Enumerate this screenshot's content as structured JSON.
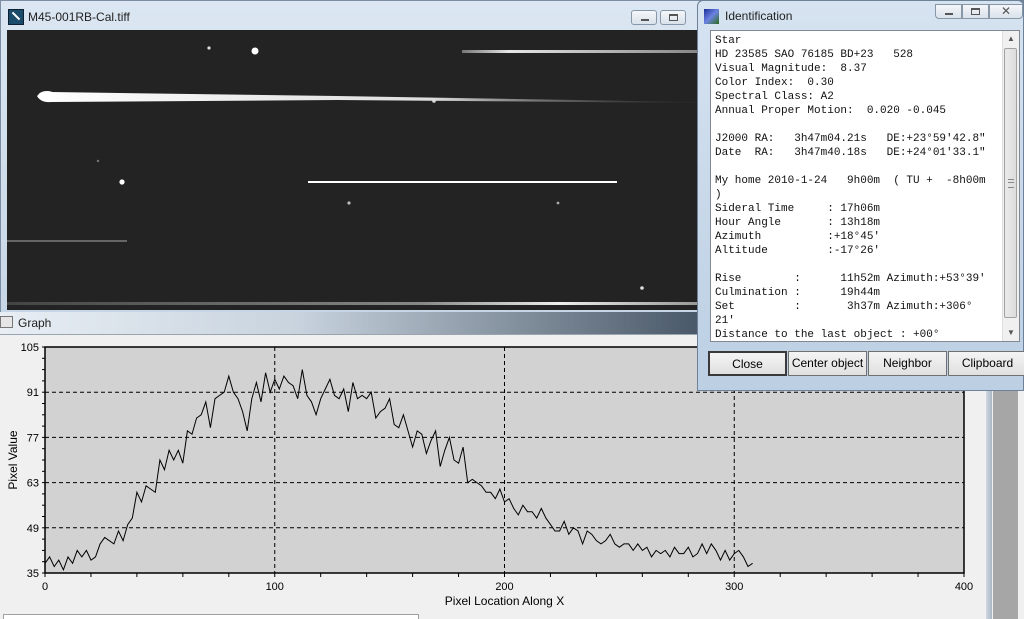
{
  "image_window": {
    "title": "M45-001RB-Cal.tiff",
    "icon": "app-icon",
    "buttons": [
      "minimize",
      "maximize"
    ]
  },
  "identification": {
    "title": "Identification",
    "icon": "comet-icon",
    "window_buttons": [
      "minimize",
      "maximize",
      "close"
    ],
    "lines": [
      "Star",
      "HD 23585 SAO 76185 BD+23   528",
      "Visual Magnitude:  8.37",
      "Color Index:  0.30",
      "Spectral Class: A2",
      "Annual Proper Motion:  0.020 -0.045",
      "",
      "J2000 RA:   3h47m04.21s   DE:+23°59'42.8\"",
      "Date  RA:   3h47m40.18s   DE:+24°01'33.1\"",
      "",
      "My home 2010-1-24   9h00m  ( TU +  -8h00m",
      ")",
      "Sideral Time     : 17h06m",
      "Hour Angle       : 13h18m",
      "Azimuth          :+18°45'",
      "Altitude         :-17°26'",
      "",
      "Rise        :      11h52m Azimuth:+53°39'",
      "Culmination :      19h44m",
      "Set         :       3h37m Azimuth:+306°",
      "21'",
      "Distance to the last object : +00°"
    ],
    "buttons": {
      "close": "Close",
      "center": "Center object",
      "neighbor": "Neighbor",
      "clipboard": "Clipboard"
    }
  },
  "graph_window": {
    "title": "Graph",
    "icon": "graph-icon"
  },
  "chart_data": {
    "type": "line",
    "title": "",
    "xlabel": "Pixel Location Along X",
    "ylabel": "Pixel Value",
    "xlim": [
      0,
      400
    ],
    "ylim": [
      35,
      105
    ],
    "xticks": [
      0,
      100,
      200,
      300,
      400
    ],
    "yticks": [
      35,
      49,
      63,
      77,
      91,
      105
    ],
    "grid": true,
    "series": [
      {
        "name": "profile",
        "x": [
          0,
          2,
          4,
          6,
          8,
          10,
          12,
          14,
          16,
          18,
          20,
          22,
          24,
          26,
          28,
          30,
          32,
          34,
          36,
          38,
          40,
          42,
          44,
          46,
          48,
          50,
          52,
          54,
          56,
          58,
          60,
          62,
          64,
          66,
          68,
          70,
          72,
          74,
          76,
          78,
          80,
          82,
          84,
          86,
          88,
          90,
          92,
          94,
          96,
          98,
          100,
          102,
          104,
          106,
          108,
          110,
          112,
          114,
          116,
          118,
          120,
          122,
          124,
          126,
          128,
          130,
          132,
          134,
          136,
          138,
          140,
          142,
          144,
          146,
          148,
          150,
          152,
          154,
          156,
          158,
          160,
          162,
          164,
          166,
          168,
          170,
          172,
          174,
          176,
          178,
          180,
          182,
          184,
          186,
          188,
          190,
          192,
          194,
          196,
          198,
          200,
          202,
          204,
          206,
          208,
          210,
          212,
          214,
          216,
          218,
          220,
          222,
          224,
          226,
          228,
          230,
          232,
          234,
          236,
          238,
          240,
          242,
          244,
          246,
          248,
          250,
          252,
          254,
          256,
          258,
          260,
          262,
          264,
          266,
          268,
          270,
          272,
          274,
          276,
          278,
          280,
          282,
          284,
          286,
          288,
          290,
          292,
          294,
          296,
          298,
          300,
          302,
          304,
          306,
          308
        ],
        "y": [
          38,
          40,
          37,
          39,
          36,
          40,
          38,
          42,
          40,
          42,
          39,
          40,
          44,
          46,
          45,
          44,
          48,
          45,
          50,
          52,
          60,
          57,
          62,
          61,
          60,
          70,
          67,
          73,
          70,
          73,
          69,
          79,
          78,
          83,
          84,
          88,
          80,
          89,
          90,
          91,
          96,
          91,
          89,
          85,
          79,
          89,
          94,
          88,
          97,
          91,
          95,
          92,
          96,
          94,
          93,
          89,
          98,
          90,
          88,
          84,
          89,
          92,
          95,
          90,
          89,
          92,
          85,
          94,
          89,
          90,
          89,
          91,
          83,
          85,
          86,
          89,
          81,
          80,
          84,
          79,
          74,
          79,
          78,
          72,
          76,
          79,
          68,
          73,
          77,
          70,
          69,
          74,
          63,
          64,
          63,
          62,
          60,
          60,
          58,
          61,
          57,
          58,
          55,
          53,
          56,
          54,
          54,
          52,
          55,
          52,
          50,
          48,
          48,
          51,
          47,
          49,
          48,
          44,
          48,
          47,
          45,
          44,
          45,
          47,
          44,
          43,
          44,
          44,
          42,
          44,
          42,
          43,
          40,
          42,
          41,
          42,
          40,
          43,
          41,
          41,
          43,
          40,
          41,
          44,
          41,
          44,
          42,
          39,
          42,
          39,
          41,
          42,
          40,
          37,
          38,
          40
        ]
      }
    ]
  }
}
